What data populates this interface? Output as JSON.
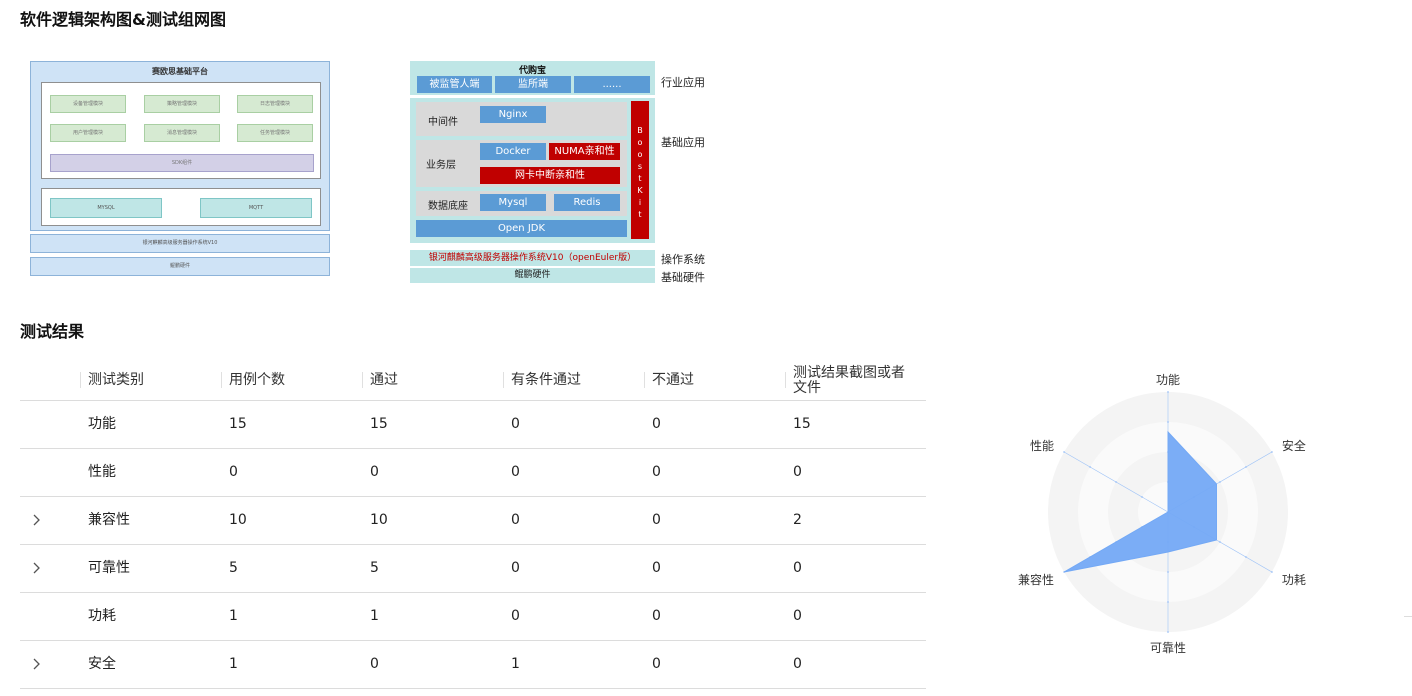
{
  "titles": {
    "architecture": "软件逻辑架构图&测试组网图",
    "results": "测试结果"
  },
  "left_diagram": {
    "platform_title": "赛欧思基础平台",
    "modules": [
      "设备管理模块",
      "策略管理模块",
      "日志管理模块",
      "用户管理模块",
      "消息管理模块",
      "任务管理模块"
    ],
    "sdk": "SDK组件",
    "databases": [
      "MYSQL",
      "MQTT"
    ],
    "os": "银河麒麟高级服务器操作系统V10",
    "hardware": "鲲鹏硬件"
  },
  "right_diagram": {
    "app_title": "代购宝",
    "app_items": [
      "被监管人端",
      "监所端",
      "......"
    ],
    "middleware_label": "中间件",
    "nginx": "Nginx",
    "business_label": "业务层",
    "docker": "Docker",
    "numa": "NUMA亲和性",
    "nic": "网卡中断亲和性",
    "db_label": "数据底座",
    "mysql": "Mysql",
    "redis": "Redis",
    "jdk": "Open JDK",
    "boostkit": [
      "B",
      "o",
      "o",
      "s",
      "t",
      "K",
      "i",
      "t"
    ],
    "os": "银河麒麟高级服务器操作系统V10（openEuler版）",
    "hardware": "鲲鹏硬件",
    "side_labels": {
      "industry": "行业应用",
      "basic": "基础应用",
      "os": "操作系统",
      "hardware": "基础硬件"
    }
  },
  "table": {
    "headers": [
      "测试类别",
      "用例个数",
      "通过",
      "有条件通过",
      "不通过",
      "测试结果截图或者文件"
    ],
    "rows": [
      {
        "category": "功能",
        "cases": "15",
        "passed": "15",
        "conditional": "0",
        "failed": "0",
        "files": "15",
        "expandable": false
      },
      {
        "category": "性能",
        "cases": "0",
        "passed": "0",
        "conditional": "0",
        "failed": "0",
        "files": "0",
        "expandable": false
      },
      {
        "category": "兼容性",
        "cases": "10",
        "passed": "10",
        "conditional": "0",
        "failed": "0",
        "files": "2",
        "expandable": true
      },
      {
        "category": "可靠性",
        "cases": "5",
        "passed": "5",
        "conditional": "0",
        "failed": "0",
        "files": "0",
        "expandable": true
      },
      {
        "category": "功耗",
        "cases": "1",
        "passed": "1",
        "conditional": "0",
        "failed": "0",
        "files": "0",
        "expandable": false
      },
      {
        "category": "安全",
        "cases": "1",
        "passed": "0",
        "conditional": "1",
        "failed": "0",
        "files": "0",
        "expandable": true
      }
    ]
  },
  "chart_data": {
    "type": "radar",
    "indicators": [
      "功能",
      "安全",
      "功耗",
      "可靠性",
      "兼容性",
      "性能"
    ],
    "max": 15,
    "values": [
      10,
      7,
      7,
      5,
      15,
      0
    ],
    "fill_color": "#74a9f5",
    "grid_colors": [
      "#f4f4f4",
      "#fafafa"
    ]
  }
}
